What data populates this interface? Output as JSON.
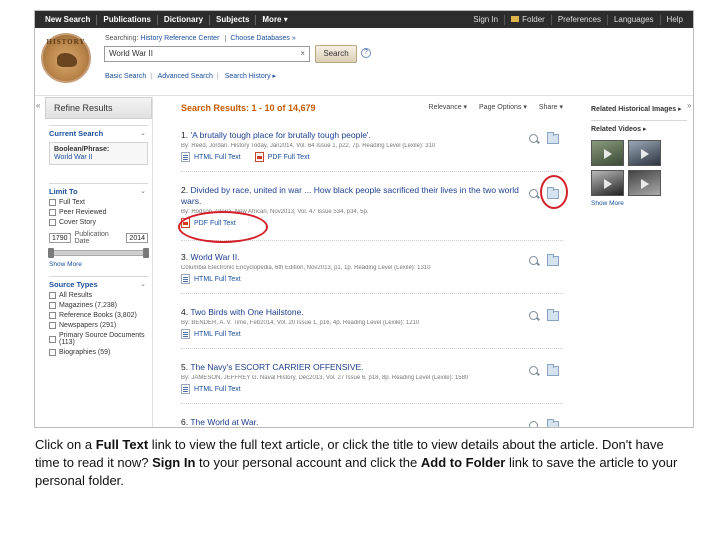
{
  "nav": {
    "left": [
      "New Search",
      "Publications",
      "Dictionary",
      "Subjects",
      "More ▾"
    ],
    "right": [
      "Sign In",
      "Folder",
      "Preferences",
      "Languages",
      "Help"
    ]
  },
  "header": {
    "logo_text": "HISTORY",
    "searching_label": "Searching:",
    "database": "History Reference Center",
    "choose_db": "Choose Databases »",
    "query": "World War II",
    "clear": "×",
    "search_button": "Search",
    "help": "?",
    "sublinks": [
      "Basic Search",
      "Advanced Search",
      "Search History ▸"
    ]
  },
  "left_panel": {
    "title": "Refine Results",
    "current_search": {
      "title": "Current Search",
      "boolean_title": "Boolean/Phrase:",
      "boolean_value": "World War II"
    },
    "limit_to": {
      "title": "Limit To",
      "options": [
        "Full Text",
        "Peer Reviewed",
        "Cover Story"
      ],
      "date_from": "1790",
      "date_label": "Publication Date",
      "date_to": "2014",
      "show_more": "Show More"
    },
    "source_types": {
      "title": "Source Types",
      "options": [
        "All Results",
        "Magazines (7,238)",
        "Reference Books (3,802)",
        "Newspapers (291)",
        "Primary Source Documents (113)",
        "Biographies (59)"
      ]
    }
  },
  "results": {
    "heading": "Search Results: 1 - 10 of 14,679",
    "controls": [
      "Relevance ▾",
      "Page Options ▾",
      "Share ▾"
    ],
    "items": [
      {
        "num": "1.",
        "title": "'A brutally tough place for brutally tough people'.",
        "meta": "By: Reed, Jordan. History Today, Jan2014, Vol. 64 Issue 1, p22, 7p. Reading Level (Lexile): 310",
        "links": [
          "HTML Full Text",
          "PDF Full Text"
        ]
      },
      {
        "num": "2.",
        "title": "Divided by race, united in war ... How black people sacrificed their lives in the two world wars.",
        "meta": "By: Hodson, Gloria. New African, Nov2013, Vol. 47 Issue 534, p34, 5p.",
        "links": [
          "PDF Full Text"
        ]
      },
      {
        "num": "3.",
        "title": "World War II.",
        "meta": "Columbia Electronic Encyclopedia, 6th Edition, Nov2013, p1, 1p. Reading Level (Lexile): 1310",
        "links": [
          "HTML Full Text"
        ]
      },
      {
        "num": "4.",
        "title": "Two Birds with One Hailstone.",
        "meta": "By: BENDER, A. V. Time, Feb2014, Vol. 20 Issue 1, p16, 4p. Reading Level (Lexile): 1210",
        "links": [
          "HTML Full Text"
        ]
      },
      {
        "num": "5.",
        "title": "The Navy's ESCORT CARRIER OFFENSIVE.",
        "meta": "By: JAMESON, JEFFREY G. Naval History, Dec2013, Vol. 27 Issue 6, p18, 8p. Reading Level (Lexile): 1580",
        "links": [
          "HTML Full Text"
        ]
      },
      {
        "num": "6.",
        "title": "The World at War.",
        "meta": "",
        "links": []
      }
    ]
  },
  "right_panel": {
    "images_title": "Related Historical Images",
    "images_arrow": "▸",
    "videos_title": "Related Videos",
    "videos_arrow": "▸",
    "more": "Show More"
  },
  "caption": {
    "p1": "Click on a ",
    "b1": "Full Text",
    "p2": " link to view the full text article, or click the title to view details about the article. Don't have time to read it now? ",
    "b2": "Sign In",
    "p3": " to your personal account and click the ",
    "b3": "Add to Folder",
    "p4": " link to save the article to your personal folder."
  },
  "colors": {
    "annotation": "#d4202a",
    "results_heading": "#c65a00",
    "link": "#1a4f9c",
    "nav_bg": "#2d2d2d"
  }
}
